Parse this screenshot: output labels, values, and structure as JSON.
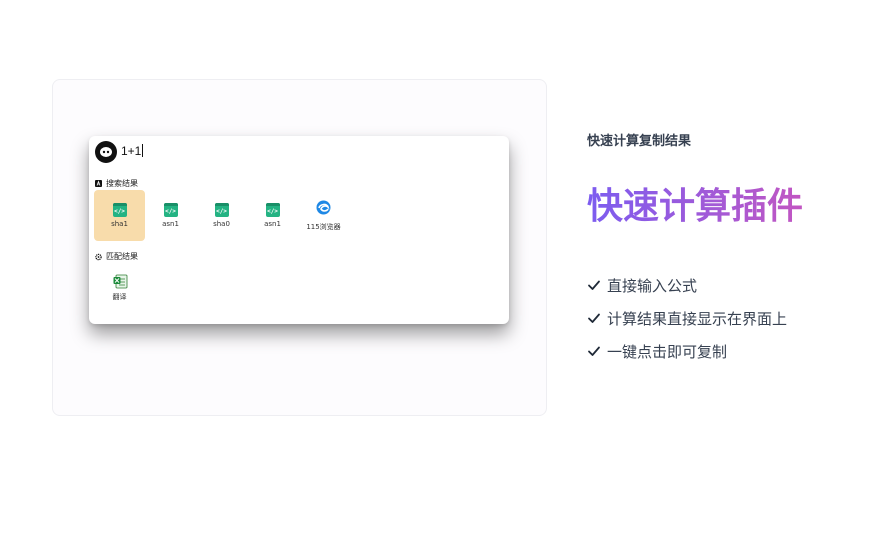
{
  "preview": {
    "search": {
      "query": "1+1"
    },
    "sections": {
      "search_results": "搜索结果",
      "match_results": "匹配结果"
    },
    "search_tiles": [
      {
        "label": "sha1",
        "icon": "code-icon",
        "selected": true
      },
      {
        "label": "asn1",
        "icon": "code-icon",
        "selected": false
      },
      {
        "label": "sha0",
        "icon": "code-icon",
        "selected": false
      },
      {
        "label": "asn1",
        "icon": "code-icon",
        "selected": false
      },
      {
        "label": "115浏览器",
        "icon": "browser-icon",
        "selected": false
      }
    ],
    "match_tiles": [
      {
        "label": "翻译",
        "icon": "spreadsheet-icon",
        "selected": false
      }
    ],
    "colors": {
      "selected_tile": "#f8dcab",
      "code_icon": "#24b383"
    }
  },
  "info": {
    "eyebrow": "快速计算复制结果",
    "headline": "快速计算插件",
    "features": [
      "直接输入公式",
      "计算结果直接显示在界面上",
      "一键点击即可复制"
    ],
    "headline_gradient": [
      "#7c5cf0",
      "#c256c2"
    ]
  }
}
